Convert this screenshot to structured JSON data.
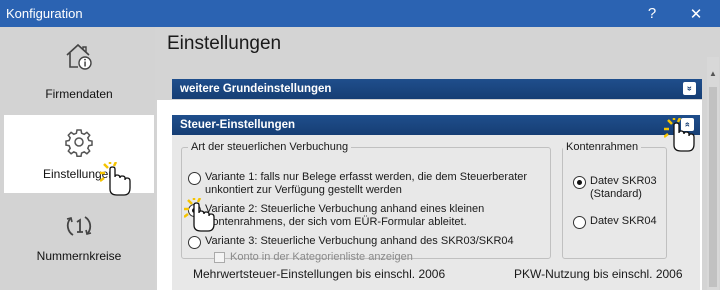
{
  "window": {
    "title": "Konfiguration",
    "help_label": "?",
    "close_label": "✕"
  },
  "sidebar": {
    "items": [
      {
        "label": "Firmendaten",
        "icon": "house-info-icon",
        "selected": false
      },
      {
        "label": "Einstellungen",
        "icon": "gear-icon",
        "selected": true
      },
      {
        "label": "Nummernkreise",
        "icon": "number-cycle-icon",
        "selected": false
      }
    ]
  },
  "main": {
    "title": "Einstellungen",
    "sections": [
      {
        "title": "weitere Grundeinstellungen",
        "toggle": "»"
      },
      {
        "title": "Steuer-Einstellungen",
        "toggle": "«"
      }
    ],
    "verbuchung": {
      "legend": "Art der steuerlichen Verbuchung",
      "options": [
        {
          "label": "Variante 1: falls nur Belege erfasst werden, die dem Steuerberater unkontiert zur Verfügung gestellt werden",
          "checked": false
        },
        {
          "label": "Variante 2: Steuerliche Verbuchung anhand eines kleinen Kontenrahmens, der sich vom EÜR-Formular ableitet.",
          "checked": true
        },
        {
          "label": "Variante 3: Steuerliche Verbuchung anhand des SKR03/SKR04",
          "checked": false
        }
      ],
      "checkbox_label": "Konto in der Kategorienliste anzeigen",
      "checkbox_checked": false
    },
    "kontenrahmen": {
      "legend": "Kontenrahmen",
      "options": [
        {
          "label": "Datev SKR03 (Standard)",
          "checked": true
        },
        {
          "label": "Datev SKR04",
          "checked": false
        }
      ]
    },
    "footer": {
      "mwst_label": "Mehrwertsteuer-Einstellungen bis einschl. 2006",
      "pkw_label": "PKW-Nutzung bis einschl. 2006"
    }
  },
  "colors": {
    "titlebar": "#2b63b2",
    "section_header": "#163e74",
    "sidebar_bg": "#d3d3d3",
    "click_glow": "#f5c400"
  }
}
